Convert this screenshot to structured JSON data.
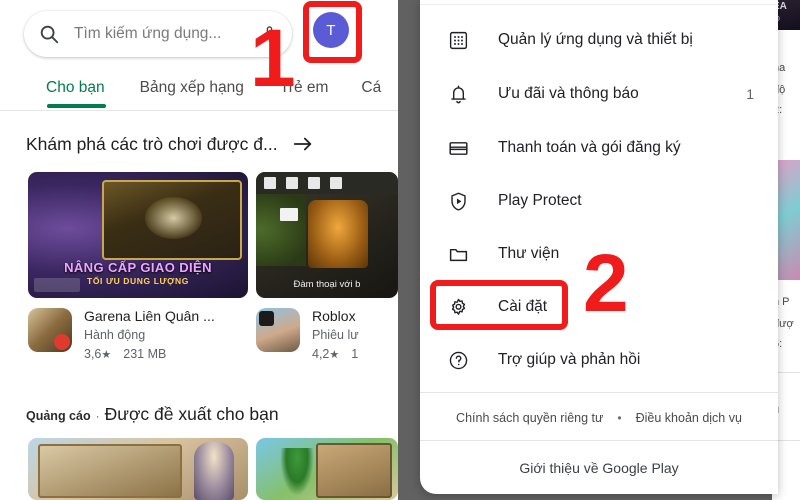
{
  "left_panel": {
    "search": {
      "placeholder": "Tìm kiếm ứng dụng...",
      "search_icon": "search-icon",
      "mic_icon": "microphone-icon"
    },
    "avatar": {
      "initial": "T",
      "color": "#5b5bd6"
    },
    "tabs": [
      {
        "label": "Cho bạn",
        "active": true
      },
      {
        "label": "Bảng xếp hạng",
        "active": false
      },
      {
        "label": "Trẻ em",
        "active": false
      },
      {
        "label": "Cá",
        "active": false
      }
    ],
    "explore": {
      "title": "Khám phá các trò chơi được đ...",
      "arrow_icon": "arrow-right-icon"
    },
    "feature_cards": [
      {
        "caption_main": "NÂNG CẤP GIAO DIỆN",
        "caption_sub": "TỐI ƯU DUNG LƯỢNG"
      },
      {
        "caption_main": "Đàm thoại với b"
      }
    ],
    "apps": [
      {
        "name": "Garena Liên Quân ...",
        "genre": "Hành động",
        "rating": "3,6",
        "star": "★",
        "size": "231 MB"
      },
      {
        "name": "Roblox",
        "genre": "Phiêu lư",
        "rating": "4,2",
        "star": "★",
        "size": "1"
      }
    ],
    "ads_section": {
      "label": "Quảng cáo",
      "dot": "·",
      "title": "Được đề xuất cho bạn"
    }
  },
  "menu": {
    "items": [
      {
        "label": "Quản lý ứng dụng và thiết bị",
        "icon": "apps-grid-icon",
        "badge": ""
      },
      {
        "label": "Ưu đãi và thông báo",
        "icon": "bell-icon",
        "badge": "1"
      },
      {
        "label": "Thanh toán và gói đăng ký",
        "icon": "credit-card-icon",
        "badge": ""
      },
      {
        "label": "Play Protect",
        "icon": "shield-play-icon",
        "badge": ""
      },
      {
        "label": "Thư viện",
        "icon": "folder-icon",
        "badge": ""
      },
      {
        "label": "Cài đặt",
        "icon": "gear-icon",
        "badge": ""
      },
      {
        "label": "Trợ giúp và phản hồi",
        "icon": "help-circle-icon",
        "badge": ""
      }
    ],
    "legal": {
      "privacy": "Chính sách quyền riêng tư",
      "separator": "•",
      "terms": "Điều khoản dịch vụ"
    },
    "about": "Giới thiệu về Google Play"
  },
  "annotations": [
    {
      "number": "1",
      "color": "#f01c1c",
      "target": "avatar"
    },
    {
      "number": "2",
      "color": "#f01c1c",
      "target": "settings-menu-item"
    }
  ],
  "background_peek": {
    "banner_line1": "EA",
    "banner_line2": "lo",
    "lines": [
      "na",
      "độ",
      "2:",
      "h P",
      "đượ",
      "6:",
      "u"
    ]
  }
}
